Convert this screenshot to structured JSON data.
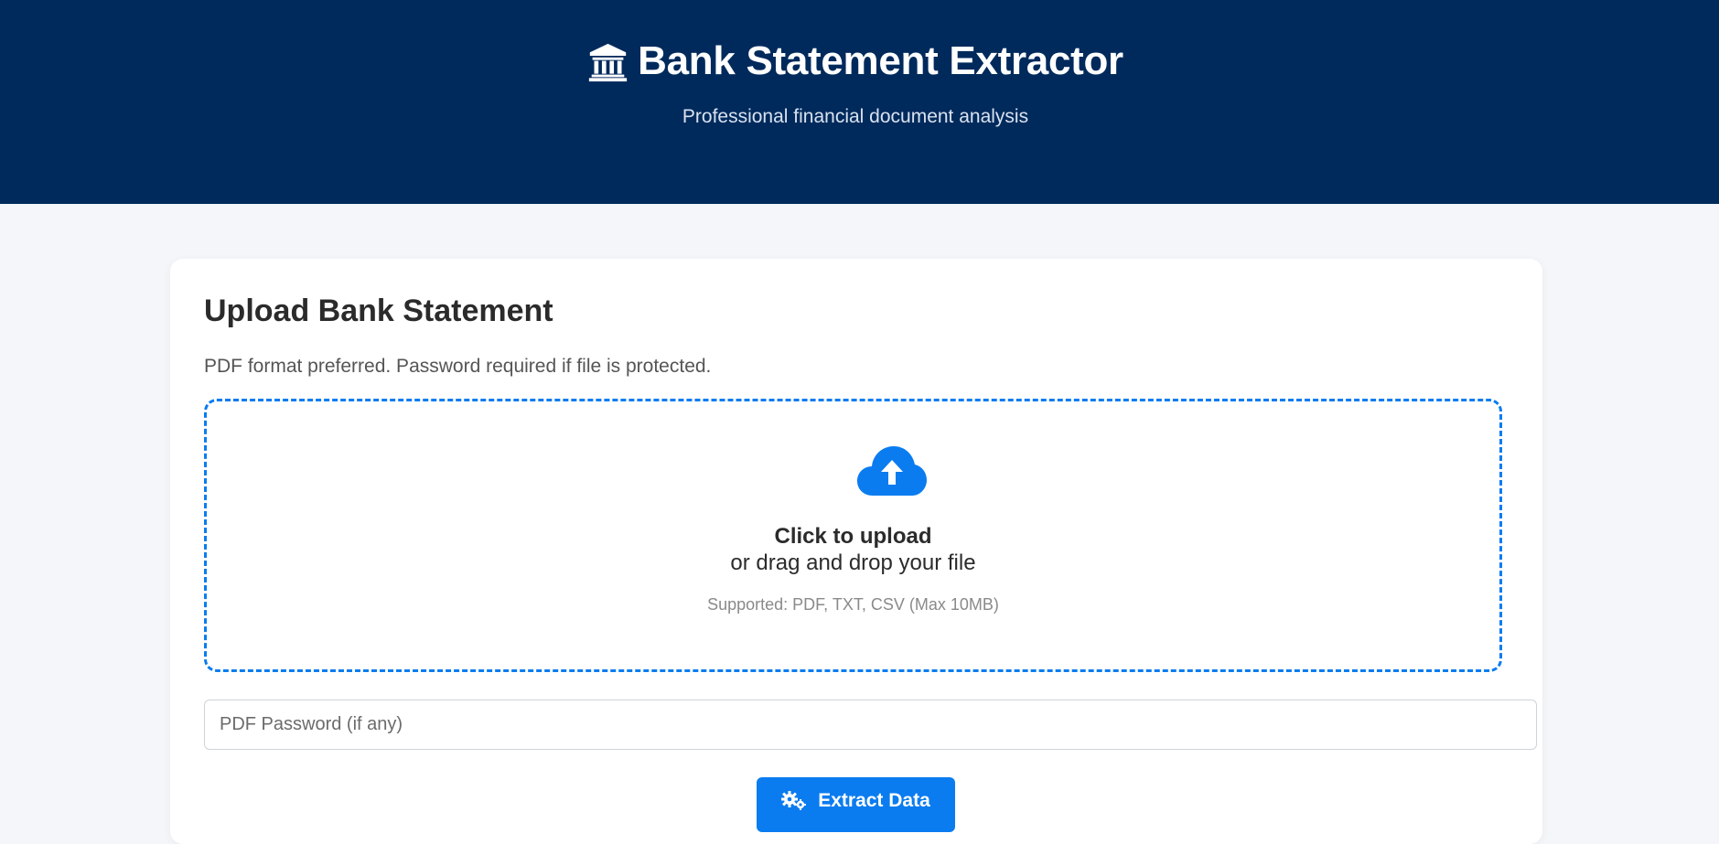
{
  "header": {
    "icon": "bank-icon",
    "title": "Bank Statement Extractor",
    "subtitle": "Professional financial document analysis"
  },
  "upload_card": {
    "title": "Upload Bank Statement",
    "description": "PDF format preferred. Password required if file is protected.",
    "dropzone": {
      "icon": "cloud-upload-icon",
      "primary_text": "Click to upload",
      "secondary_text": "or drag and drop your file",
      "hint": "Supported: PDF, TXT, CSV (Max 10MB)"
    },
    "password_field": {
      "placeholder": "PDF Password (if any)",
      "value": ""
    },
    "extract_button": {
      "icon": "gears-icon",
      "label": "Extract Data"
    }
  },
  "colors": {
    "header_bg": "#002a5c",
    "accent": "#0a7cf0",
    "page_bg": "#f4f6f9"
  }
}
